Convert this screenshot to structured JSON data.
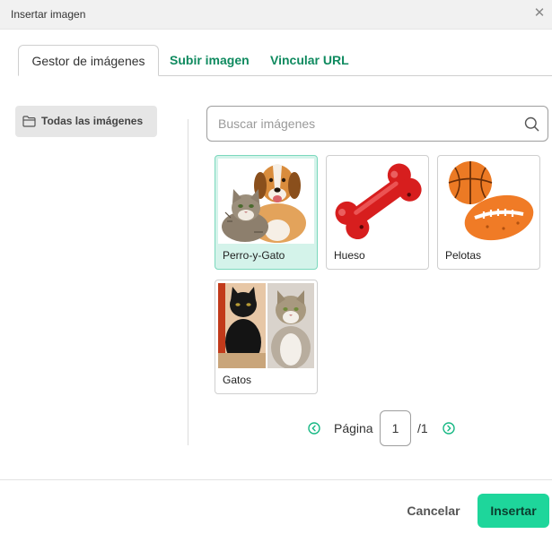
{
  "dialog": {
    "title": "Insertar imagen",
    "close_icon": "close-icon"
  },
  "tabs": [
    {
      "label": "Gestor de imágenes",
      "active": true
    },
    {
      "label": "Subir imagen",
      "active": false
    },
    {
      "label": "Vincular URL",
      "active": false
    }
  ],
  "sidebar": {
    "items": [
      {
        "label": "Todas las imágenes",
        "icon": "folder-icon",
        "active": true
      }
    ]
  },
  "search": {
    "placeholder": "Buscar imágenes",
    "value": "",
    "icon": "search-icon"
  },
  "images": [
    {
      "label": "Perro-y-Gato",
      "selected": true
    },
    {
      "label": "Hueso",
      "selected": false
    },
    {
      "label": "Pelotas",
      "selected": false
    },
    {
      "label": "Gatos",
      "selected": false
    }
  ],
  "pagination": {
    "label": "Página",
    "current": "1",
    "total": "/1",
    "prev_icon": "chevron-left-circle-icon",
    "next_icon": "chevron-right-circle-icon"
  },
  "footer": {
    "cancel_label": "Cancelar",
    "insert_label": "Insertar"
  },
  "colors": {
    "accent": "#1ed69b",
    "link": "#0f8a5f",
    "selected_card": "#d4f3ea"
  }
}
